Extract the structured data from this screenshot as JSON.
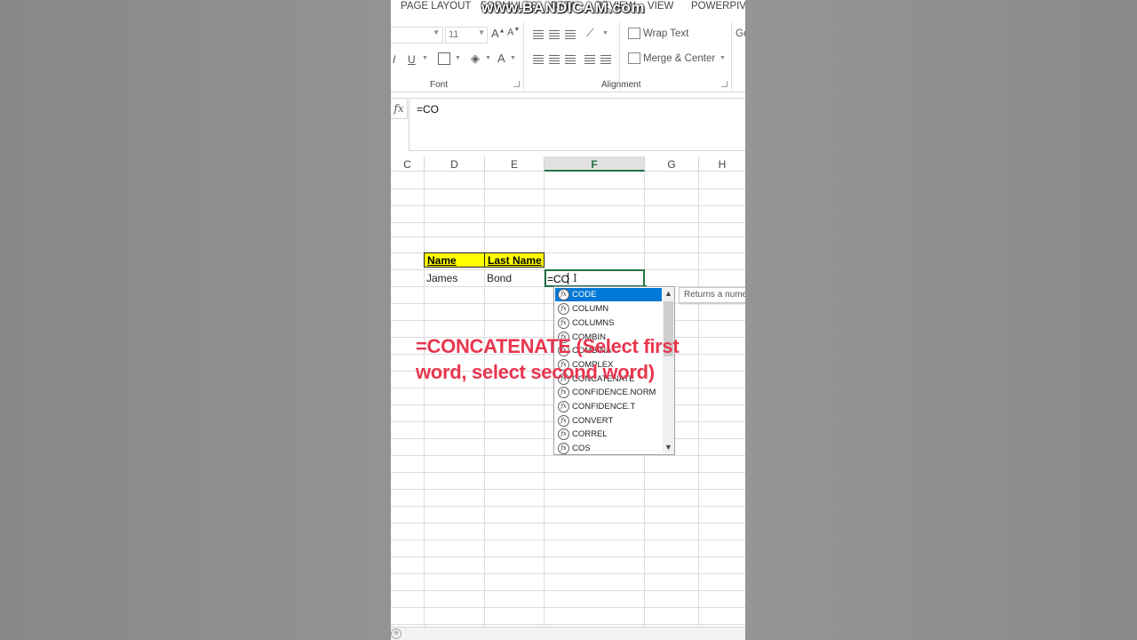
{
  "ribbon": {
    "tabs": [
      "PAGE LAYOUT",
      "FORMULAS",
      "DATA",
      "REVIEW",
      "VIEW",
      "POWERPIVO"
    ],
    "watermark": "www.BANDICAM.com",
    "font_size": "11",
    "wrap_text": "Wrap Text",
    "merge_center": "Merge & Center",
    "font_group": "Font",
    "alignment_group": "Alignment",
    "bold_label": "I",
    "underline_label": "U",
    "font_color_label": "A",
    "general_cut": "Ge"
  },
  "formula_bar": {
    "fx_label": "fx",
    "value": "=CO"
  },
  "columns": [
    "C",
    "D",
    "E",
    "F",
    "G",
    "H"
  ],
  "selected_column": "F",
  "cells": {
    "header_name": "Name",
    "header_last_name": "Last Name",
    "name": "James",
    "last_name": "Bond",
    "editing": "=CO"
  },
  "autocomplete": {
    "items": [
      "CODE",
      "COLUMN",
      "COLUMNS",
      "COMBIN",
      "COMBINA",
      "COMPLEX",
      "CONCATENATE",
      "CONFIDENCE.NORM",
      "CONFIDENCE.T",
      "CONVERT",
      "CORREL",
      "COS"
    ],
    "selected": "CODE",
    "tooltip": "Returns a numeric code"
  },
  "overlay_text": "=CONCATENATE (Select first word, select second word)",
  "colors": {
    "accent": "#217346",
    "highlight": "#ffff00",
    "overlay": "#e8364f",
    "selection": "#0078d7"
  }
}
